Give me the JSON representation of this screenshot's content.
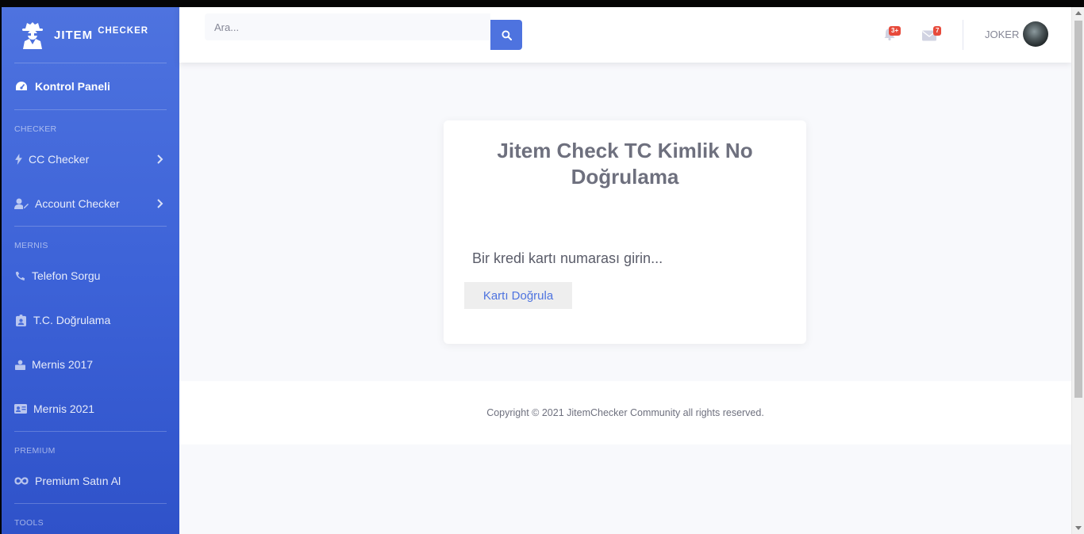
{
  "brand": {
    "name_part1": "JITEM",
    "name_part2": "CHECKER"
  },
  "sidebar": {
    "dashboard": {
      "label": "Kontrol Paneli",
      "icon": "tachometer-icon"
    },
    "sections": [
      {
        "heading": "CHECKER",
        "items": [
          {
            "label": "CC Checker",
            "icon": "bolt-icon",
            "has_submenu": true
          },
          {
            "label": "Account Checker",
            "icon": "user-edit-icon",
            "has_submenu": true
          }
        ]
      },
      {
        "heading": "MERNIS",
        "items": [
          {
            "label": "Telefon Sorgu",
            "icon": "phone-icon"
          },
          {
            "label": "T.C. Doğrulama",
            "icon": "id-badge-icon"
          },
          {
            "label": "Mernis 2017",
            "icon": "user-group-icon"
          },
          {
            "label": "Mernis 2021",
            "icon": "id-card-icon"
          }
        ]
      },
      {
        "heading": "PREMIUM",
        "items": [
          {
            "label": "Premium Satın Al",
            "icon": "infinity-icon"
          }
        ]
      },
      {
        "heading": "TOOLS",
        "items": []
      }
    ]
  },
  "topbar": {
    "search_placeholder": "Ara...",
    "alerts_badge": "3+",
    "messages_badge": "7",
    "username": "JOKER"
  },
  "card": {
    "title": "Jitem Check TC Kimlik No Doğrulama",
    "input_placeholder": "Bir kredi kartı numarası girin...",
    "button_label": "Kartı Doğrula"
  },
  "footer": {
    "text": "Copyright © 2021 JitemChecker Community all rights reserved."
  },
  "colors": {
    "primary": "#4e73df",
    "danger": "#e74a3b",
    "text_muted": "#858796"
  }
}
